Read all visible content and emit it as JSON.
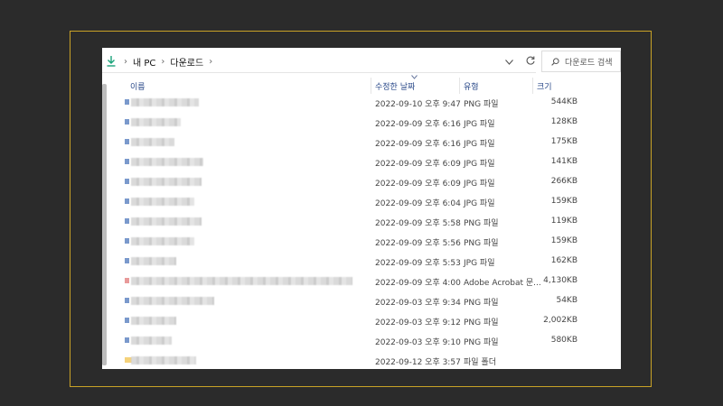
{
  "address": {
    "crumbs": [
      "내 PC",
      "다운로드"
    ],
    "separator": "›"
  },
  "search": {
    "placeholder": "다운로드 검색"
  },
  "columns": {
    "name": "이름",
    "date": "수정한 날짜",
    "type": "유형",
    "size": "크기"
  },
  "files": [
    {
      "date": "2022-09-10 오후 9:47",
      "type": "PNG 파일",
      "size": "544KB",
      "icon": "image"
    },
    {
      "date": "2022-09-09 오후 6:16",
      "type": "JPG 파일",
      "size": "128KB",
      "icon": "image"
    },
    {
      "date": "2022-09-09 오후 6:16",
      "type": "JPG 파일",
      "size": "175KB",
      "icon": "image"
    },
    {
      "date": "2022-09-09 오후 6:09",
      "type": "JPG 파일",
      "size": "141KB",
      "icon": "image"
    },
    {
      "date": "2022-09-09 오후 6:09",
      "type": "JPG 파일",
      "size": "266KB",
      "icon": "image"
    },
    {
      "date": "2022-09-09 오후 6:04",
      "type": "JPG 파일",
      "size": "159KB",
      "icon": "image"
    },
    {
      "date": "2022-09-09 오후 5:58",
      "type": "PNG 파일",
      "size": "119KB",
      "icon": "image"
    },
    {
      "date": "2022-09-09 오후 5:56",
      "type": "PNG 파일",
      "size": "159KB",
      "icon": "image"
    },
    {
      "date": "2022-09-09 오후 5:53",
      "type": "JPG 파일",
      "size": "162KB",
      "icon": "image"
    },
    {
      "date": "2022-09-09 오후 4:00",
      "type": "Adobe Acrobat 문...",
      "size": "4,130KB",
      "icon": "pdf"
    },
    {
      "date": "2022-09-03 오후 9:34",
      "type": "PNG 파일",
      "size": "54KB",
      "icon": "image"
    },
    {
      "date": "2022-09-03 오후 9:12",
      "type": "PNG 파일",
      "size": "2,002KB",
      "icon": "image"
    },
    {
      "date": "2022-09-03 오후 9:10",
      "type": "PNG 파일",
      "size": "580KB",
      "icon": "image"
    },
    {
      "date": "2022-09-12 오후 3:57",
      "type": "파일 폴더",
      "size": "",
      "icon": "folder"
    }
  ]
}
